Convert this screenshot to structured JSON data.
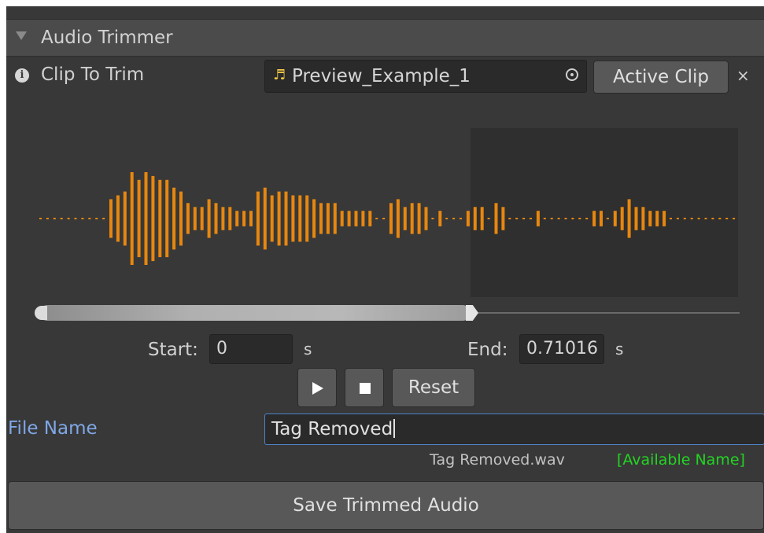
{
  "header": {
    "title": "Audio Trimmer"
  },
  "clip": {
    "label": "Clip To Trim",
    "value": "Preview_Example_1",
    "active_clip_label": "Active Clip",
    "close_glyph": "×"
  },
  "waveform": {
    "color": "#e7870f",
    "selection_end_fraction": 0.61,
    "amplitudes": [
      1,
      1,
      1,
      1,
      1,
      1,
      1,
      1,
      1,
      1,
      5,
      6,
      7,
      12,
      10,
      12,
      11,
      10,
      10,
      8,
      7,
      4,
      3,
      3,
      5,
      4,
      3,
      3,
      2,
      2,
      2,
      7,
      8,
      6,
      7,
      7,
      6,
      6,
      6,
      5,
      4,
      4,
      4,
      2,
      2,
      2,
      2,
      2,
      1,
      1,
      4,
      5,
      3,
      4,
      4,
      3,
      1,
      2,
      1,
      1,
      1,
      2,
      3,
      3,
      1,
      4,
      3,
      1,
      1,
      1,
      1,
      2,
      1,
      1,
      1,
      1,
      1,
      1,
      1,
      2,
      2,
      1,
      2,
      3,
      5,
      3,
      3,
      2,
      2,
      2,
      1,
      1,
      1,
      1,
      1,
      1,
      1,
      1,
      1,
      1
    ]
  },
  "trim": {
    "start_label": "Start:",
    "start_value": "0",
    "end_label": "End:",
    "end_value": "0.71016",
    "unit": "s",
    "selection_fraction": 0.61
  },
  "playback": {
    "reset_label": "Reset"
  },
  "file": {
    "label": "File Name",
    "value": "Tag Removed",
    "output_name": "Tag Removed.wav",
    "status": "[Available Name]",
    "status_color": "#22d422"
  },
  "actions": {
    "save_label": "Save Trimmed Audio"
  }
}
